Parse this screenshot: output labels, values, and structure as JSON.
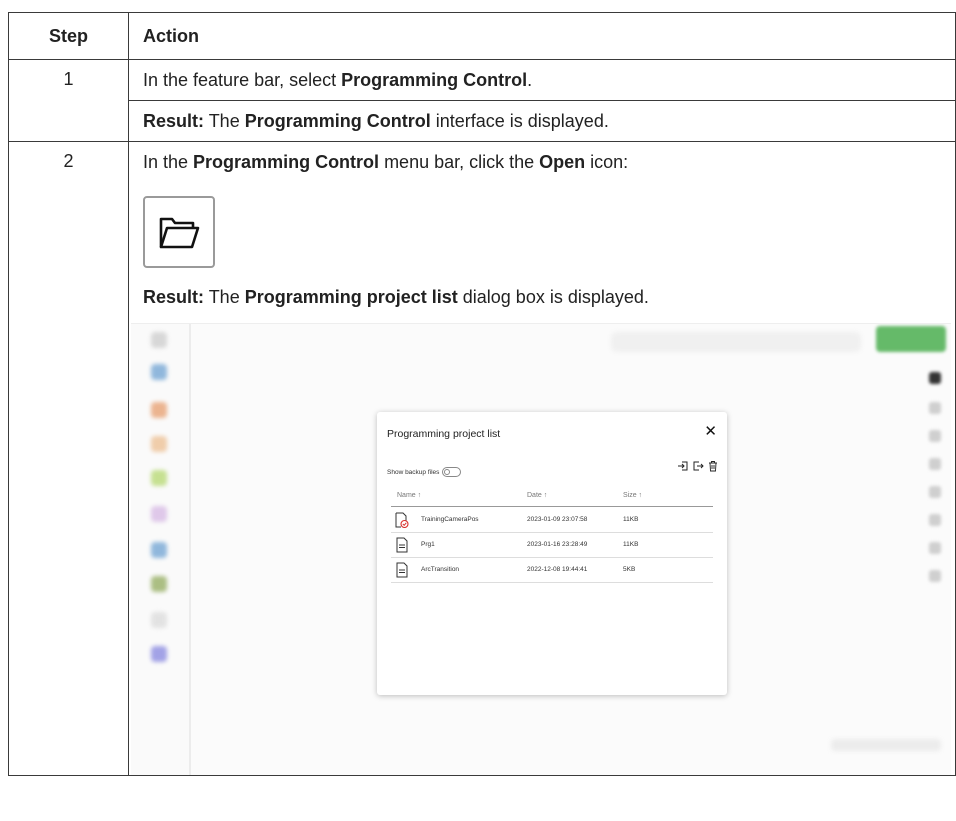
{
  "table": {
    "header": {
      "step": "Step",
      "action": "Action"
    },
    "rows": [
      {
        "step": "1",
        "instruction": {
          "pre": "In the feature bar, select ",
          "bold": "Programming Control",
          "post": "."
        },
        "result": {
          "label": "Result:",
          "pre": " The ",
          "bold": "Programming Control",
          "post": " interface is displayed."
        }
      },
      {
        "step": "2",
        "instruction": {
          "pre": "In the ",
          "bold1": "Programming Control",
          "mid": " menu bar, click the ",
          "bold2": "Open",
          "post": " icon:"
        },
        "icon_name": "open-folder-icon",
        "result": {
          "label": "Result:",
          "pre": " The ",
          "bold": "Programming project list",
          "post": " dialog box is displayed."
        }
      }
    ]
  },
  "dialog": {
    "title": "Programming project list",
    "close": "✕",
    "show_backup_label": "Show backup files",
    "columns": [
      "Name ↑",
      "Date ↑",
      "Size ↑"
    ],
    "files": [
      {
        "name": "TrainingCameraPos",
        "date": "2023-01-09 23:07:58",
        "size": "11KB",
        "icon": "file-checked-icon"
      },
      {
        "name": "Prg1",
        "date": "2023-01-16 23:28:49",
        "size": "11KB",
        "icon": "file-icon"
      },
      {
        "name": "ArcTransition",
        "date": "2022-12-08 19:44:41",
        "size": "5KB",
        "icon": "file-icon"
      }
    ]
  },
  "colors": {
    "accent_green": "#4caf50",
    "border": "#3a3a3a",
    "check_red": "#d9302c"
  }
}
